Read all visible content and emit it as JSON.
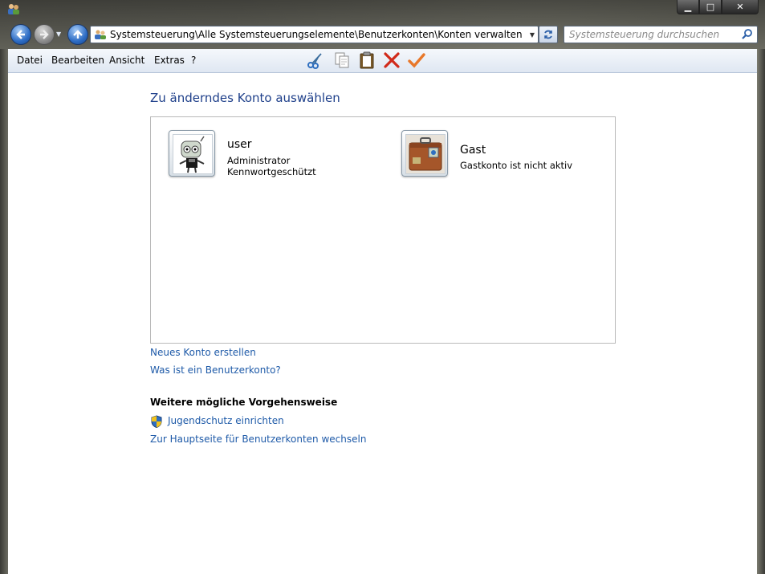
{
  "window": {
    "minimize_glyph": "▁",
    "maximize_glyph": "□",
    "close_glyph": "✕"
  },
  "nav": {
    "address_path": "Systemsteuerung\\Alle Systemsteuerungselemente\\Benutzerkonten\\Konten verwalten",
    "search_placeholder": "Systemsteuerung durchsuchen"
  },
  "menu": {
    "items": [
      "Datei",
      "Bearbeiten",
      "Ansicht",
      "Extras",
      "?"
    ]
  },
  "toolbar_icons": [
    "scissors-icon",
    "copy-icon",
    "paste-icon",
    "delete-icon",
    "checkmark-icon"
  ],
  "main": {
    "heading": "Zu änderndes Konto auswählen",
    "accounts": [
      {
        "name": "user",
        "lines": [
          "Administrator",
          "Kennwortgeschützt"
        ],
        "icon": "robot-avatar-icon"
      },
      {
        "name": "Gast",
        "lines": [
          "Gastkonto ist nicht aktiv"
        ],
        "icon": "suitcase-avatar-icon"
      }
    ],
    "links": {
      "new_account": "Neues Konto erstellen",
      "what_is": "Was ist ein Benutzerkonto?"
    },
    "section_title": "Weitere mögliche Vorgehensweise",
    "extra_links": {
      "parental": "Jugendschutz einrichten",
      "home": "Zur Hauptseite für Benutzerkonten wechseln"
    }
  },
  "colors": {
    "link": "#1e5aa8",
    "heading": "#1e3f8a"
  }
}
